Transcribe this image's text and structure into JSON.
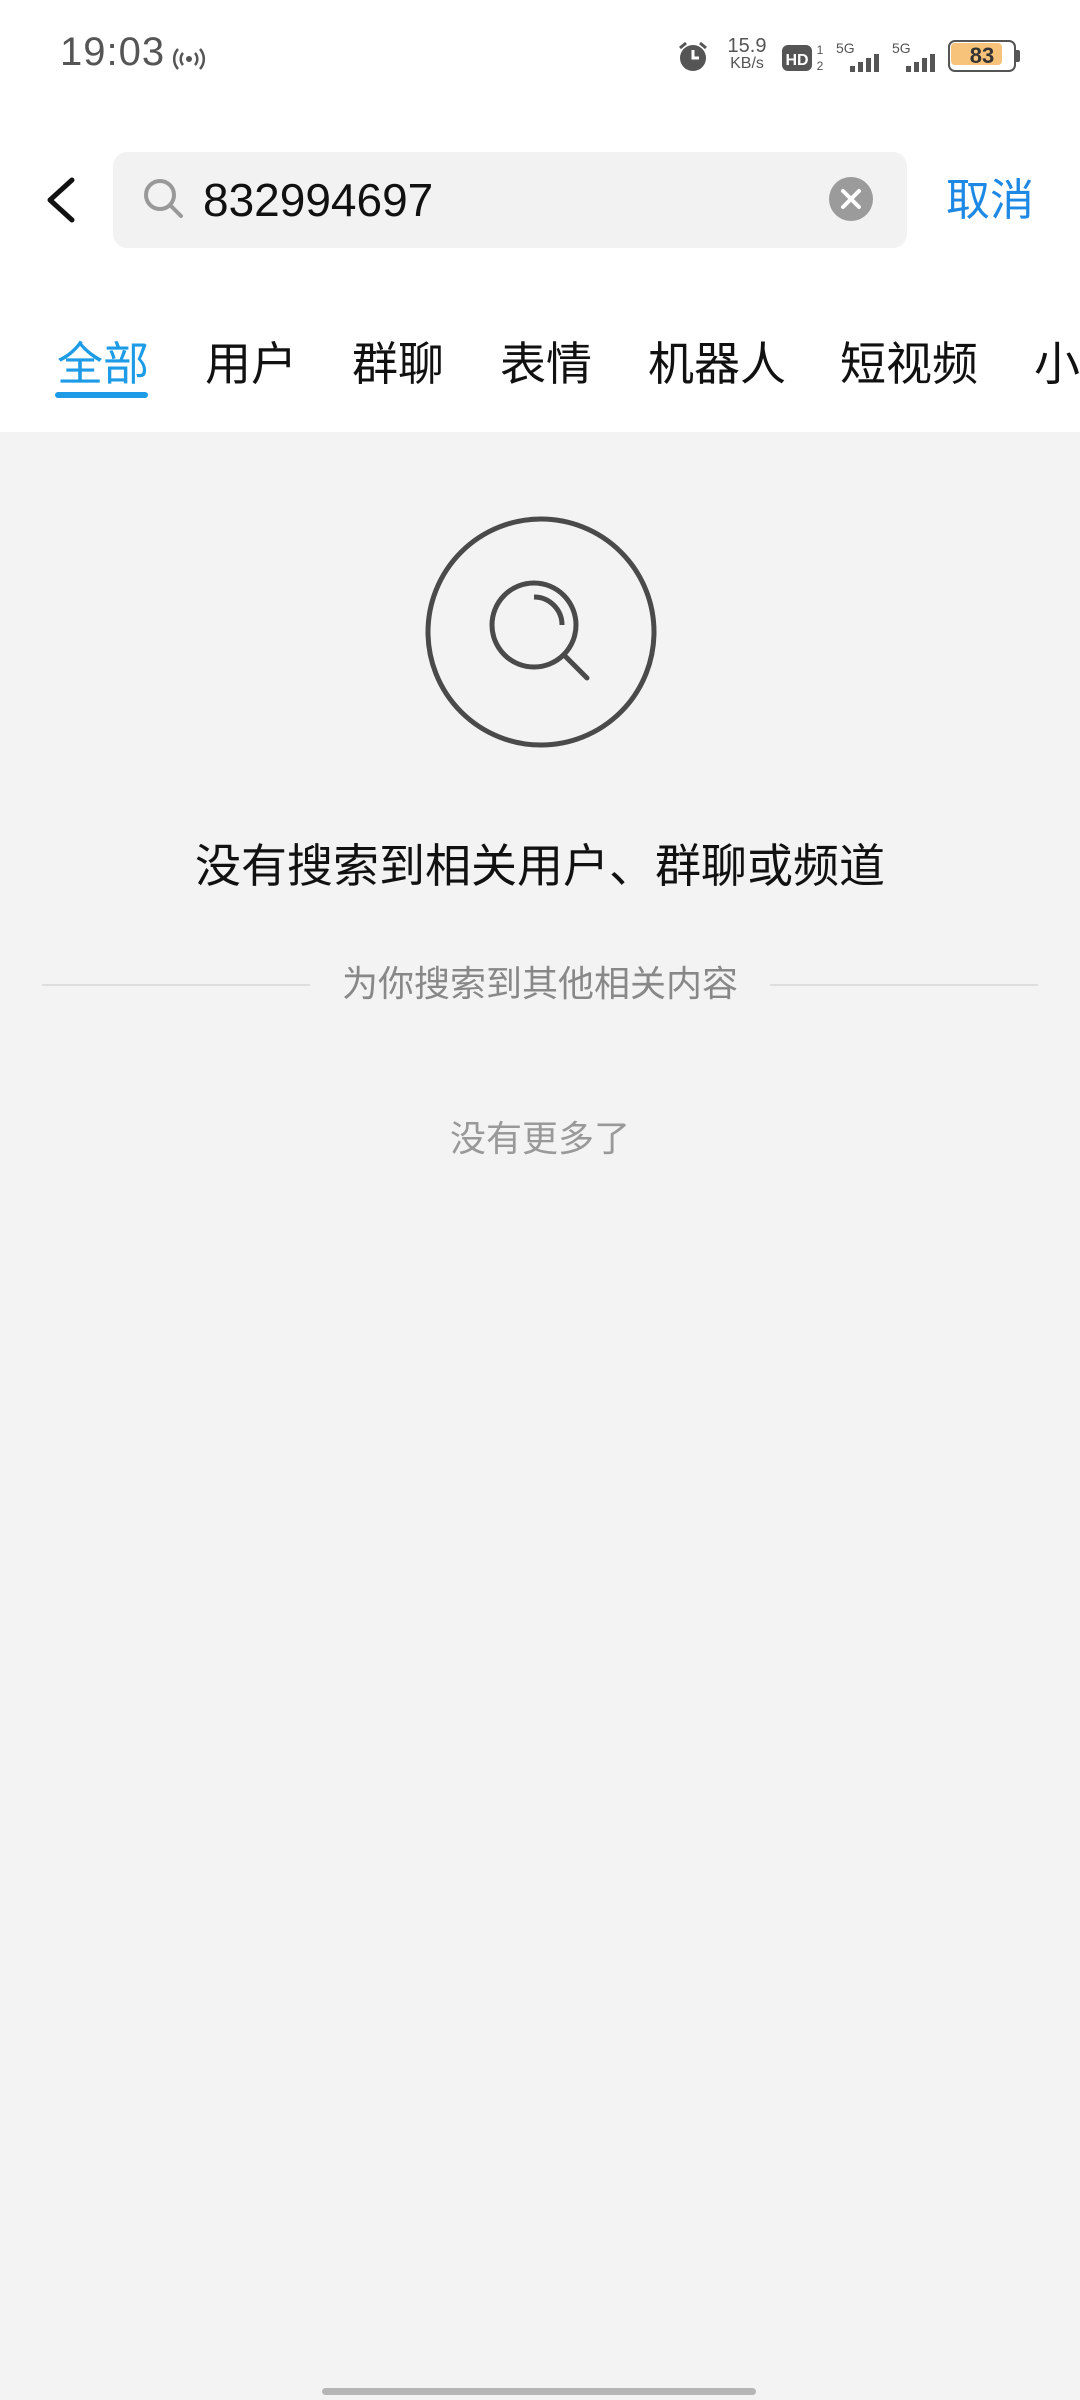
{
  "status_bar": {
    "time": "19:03",
    "net_speed_value": "15.9",
    "net_speed_unit": "KB/s",
    "hd_label": "HD",
    "sim1_label": "5G",
    "sim2_label": "5G",
    "battery_level": "83",
    "battery_color": "#f7c37b"
  },
  "search": {
    "query": "832994697",
    "cancel_label": "取消"
  },
  "tabs": [
    {
      "label": "全部",
      "active": true
    },
    {
      "label": "用户",
      "active": false
    },
    {
      "label": "群聊",
      "active": false
    },
    {
      "label": "表情",
      "active": false
    },
    {
      "label": "机器人",
      "active": false
    },
    {
      "label": "短视频",
      "active": false
    },
    {
      "label": "小",
      "active": false
    }
  ],
  "results": {
    "empty_message": "没有搜索到相关用户、群聊或频道",
    "related_divider": "为你搜索到其他相关内容",
    "no_more": "没有更多了"
  },
  "colors": {
    "accent": "#1e9be6",
    "cancel": "#1e88e5"
  }
}
